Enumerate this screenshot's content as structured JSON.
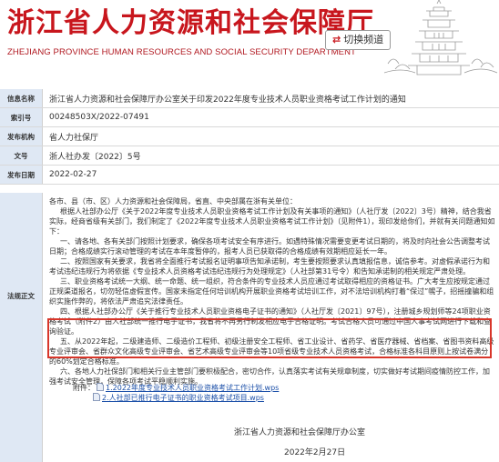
{
  "header": {
    "title": "浙江省人力资源和社会保障厅",
    "subtitle": "ZHEJIANG PROVINCE HUMAN RESOURCES AND SOCIAL SECURITY DEPARTMENT",
    "switch_icon": "⇄",
    "switch_label": "切换频道",
    "brand_color": "#c8161d"
  },
  "meta": [
    {
      "label": "信息名称",
      "value": "浙江省人力资源和社会保障厅办公室关于印发2022年度专业技术人员职业资格考试工作计划的通知"
    },
    {
      "label": "索引号",
      "value": "00248503X/2022-07491"
    },
    {
      "label": "发布机构",
      "value": "省人力社保厅"
    },
    {
      "label": "文号",
      "value": "浙人社办发〔2022〕5号"
    },
    {
      "label": "发布日期",
      "value": "2022-02-27"
    }
  ],
  "body": {
    "label": "法规正文",
    "paragraphs": [
      "各市、县（市、区）人力资源和社会保障局，省直、中央部属在浙有关单位：",
      "根据人社部办公厅《关于2022年度专业技术人员职业资格考试工作计划及有关事项的通知》（人社厅发〔2022〕3号）精神，结合我省实际，经商省级有关部门，我们制定了《2022年度专业技术人员职业资格考试工作计划》（见附件1），现印发给你们，并就有关问题通知如下：",
      "一、请各地、各有关部门按照计划要求，确保各项考试安全有序进行。如遇特殊情况需要变更考试日期的，将及时向社会公告调整考试日期；合格成绩实行滚动管理的考试在本年度暂停的，报考人员已获取得的合格成绩有效期相应延长一年。",
      "二、按照国家有关要求，我省将全面推行考试报名证明事项告知承诺制，考生要按照要求认真填报信息，诚信参考。对虚假承诺行为和考试违纪违规行为将依据《专业技术人员资格考试违纪违规行为处理规定》（人社部第31号令）和告知承诺制的相关规定严肃处理。",
      "三、职业资格考试统一大纲、统一命题、统一组织，符合条件的专业技术人员应通过考试取得相应的资格证书。广大考生应按规定通过正规渠道报名，切勿轻信虚假宣传。国家未指定任何培训机构开展职业资格考试培训工作，对不法培训机构打着“保过”幌子，招摇撞骗和组织实施作弊的，将依法严肃追究法律责任。",
      "四、根据人社部办公厅《关于推行专业技术人员职业资格电子证书的通知》（人社厅发〔2021〕97号），注册城乡规划师等24项职业资格考试（附件2）由人社部统一推行电子证书，我省将不再另行制发相应电子合格证明。考试合格人员可通过中国人事考试网进行下载和查询验证。",
      "五、从2022年起，二级建造师、二级造价工程师、初级注册安全工程师、省工业设计、省药学、省医疗器械、省档案、省图书资料高级专业评审会、省群众文化高级专业评审会、省艺术高级专业评审会等10项省级专业技术人员资格考试，合格标准各科目原则上按试卷满分的60%划定合格标准。",
      "六、各地人力社保部门和相关行业主管部门要积极配合，密切合作，认真落实考试有关规章制度，切实做好考试期间疫情防控工作，加强考试安全管理，保障各项考试平稳顺利实施。"
    ],
    "attachments_label": "附件：",
    "attachments": [
      "1.2022年度专业技术人员职业资格考试工作计划.wps",
      "2.人社部已推行电子证书的职业资格考试项目.wps"
    ],
    "signer": "浙江省人力资源和社会保障厅办公室",
    "date": "2022年2月27日",
    "highlight_color": "#d8362a"
  }
}
